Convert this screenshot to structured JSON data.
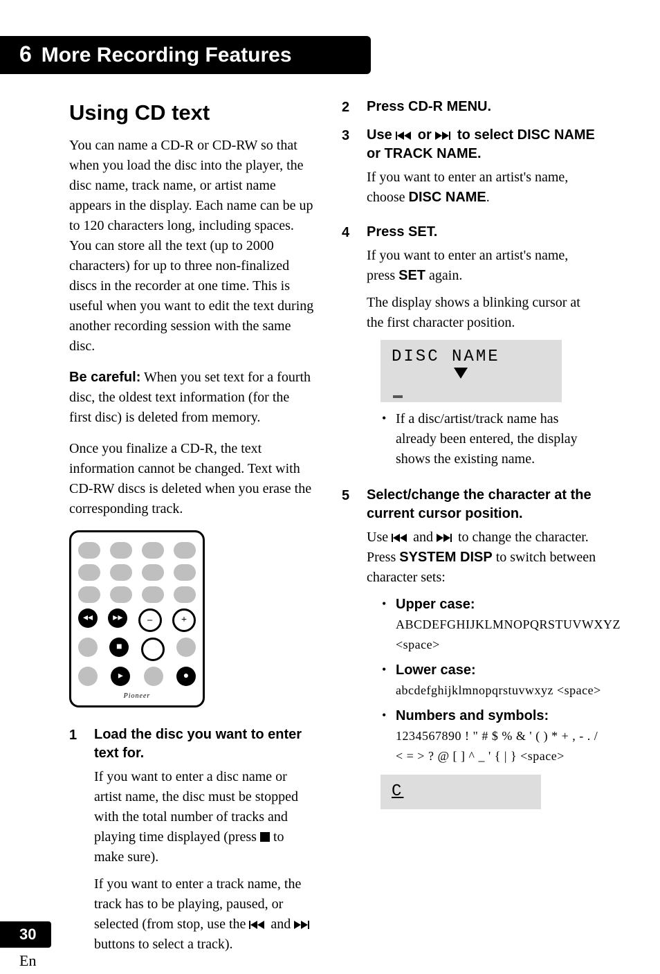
{
  "chapter": {
    "number": "6",
    "title": "More Recording Features"
  },
  "left": {
    "heading": "Using CD text",
    "p1": "You can name a CD-R or CD-RW so that when you load the disc into the player, the disc name, track name, or artist name appears in the display. Each name can be up to 120 characters long, including spaces. You can store all the text (up to 2000 characters) for up to three non-finalized discs in the recorder at one time. This is useful when you want to edit the text during another recording session with the same disc.",
    "careful_label": "Be careful:",
    "careful_text": " When you set text for a fourth disc, the oldest text information (for the first disc) is deleted from memory.",
    "p3": "Once you finalize a CD-R, the text information cannot be changed. Text with CD-RW discs is deleted when you erase the corresponding track.",
    "remote_brand": "Pioneer",
    "step1": {
      "num": "1",
      "title": "Load the disc you want to enter text for.",
      "body_a": "If you want to enter a disc name or artist name, the disc must be stopped with the total number of tracks and playing time displayed (press ",
      "body_a_end": " to make sure).",
      "body_b_pre": "If you want to enter a track name, the track has to be playing, paused, or selected (from stop, use the ",
      "body_b_mid": " and ",
      "body_b_post": " buttons to select a track)."
    }
  },
  "right": {
    "step2": {
      "num": "2",
      "title": "Press CD-R MENU."
    },
    "step3": {
      "num": "3",
      "title_pre": "Use ",
      "title_mid": " or ",
      "title_post": " to select DISC NAME or TRACK NAME.",
      "body_a": "If you want to enter an artist's name, choose ",
      "disc_name_label": "DISC NAME",
      "body_a_end": "."
    },
    "step4": {
      "num": "4",
      "title": "Press SET.",
      "body_a": "If you want to enter an artist's name, press ",
      "set_label": "SET",
      "body_a_end": " again.",
      "body_b": "The display shows a blinking cursor at the first character position.",
      "display_text": "DISC NAME",
      "bullet": "If a disc/artist/track name has already been entered, the display shows the existing name."
    },
    "step5": {
      "num": "5",
      "title": "Select/change the character at the current cursor position.",
      "body_pre": "Use ",
      "body_mid": " and ",
      "body_post": " to change the character. Press ",
      "sys_disp": "SYSTEM DISP",
      "body_end": " to switch between character sets:",
      "upper_label": "Upper case:",
      "upper_chars": "ABCDEFGHIJKLMNOPQRSTUVWXYZ <space>",
      "lower_label": "Lower case:",
      "lower_chars": "abcdefghijklmnopqrstuvwxyz <space>",
      "num_label": "Numbers and symbols:",
      "num_chars1": "1234567890 ! \" # $ % & ' ( ) * + , - . /",
      "num_chars2": "< = >  ? @ [ ] ^ _ ' { | } <space>",
      "display2": "C"
    }
  },
  "page_number": "30",
  "lang": "En"
}
